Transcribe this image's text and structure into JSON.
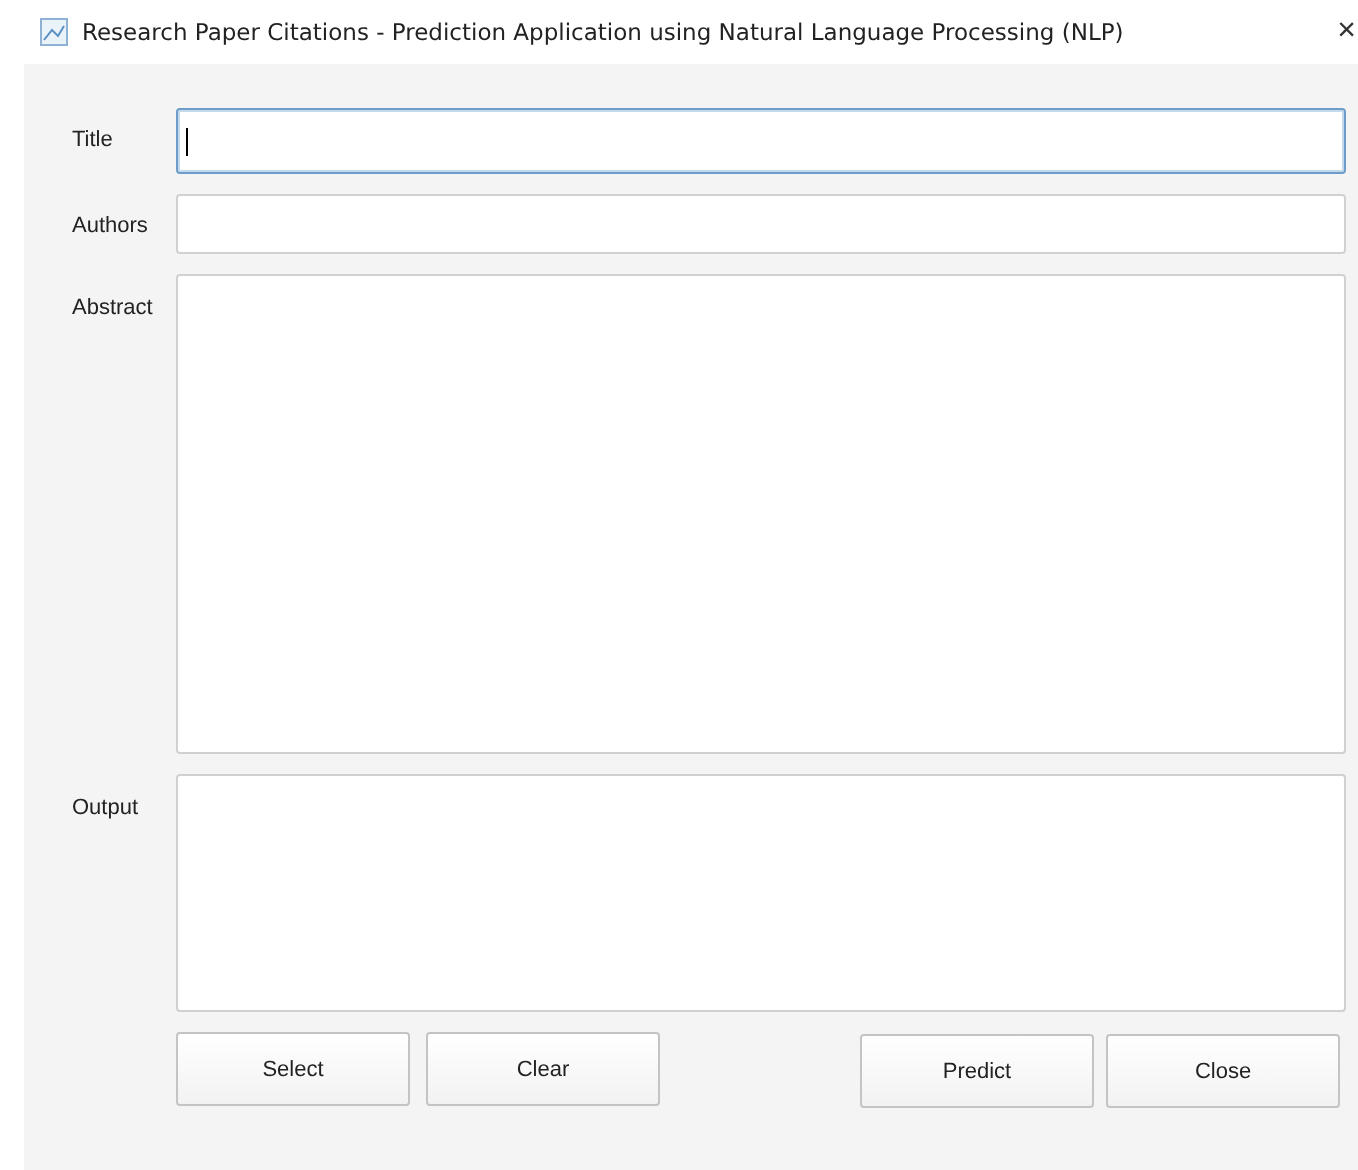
{
  "window": {
    "title": "Research Paper Citations - Prediction Application using Natural Language Processing (NLP)",
    "close": "×"
  },
  "fields": [
    {
      "label": "Title",
      "kind": "line",
      "focused": true
    },
    {
      "label": "Authors",
      "kind": "line",
      "focused": false
    },
    {
      "label": "Abstract",
      "kind": "area",
      "focused": false
    },
    {
      "label": "Output",
      "kind": "output",
      "focused": false
    }
  ],
  "buttons_left": [
    "Select",
    "Clear"
  ],
  "buttons_right": [
    "Predict",
    "Close"
  ]
}
